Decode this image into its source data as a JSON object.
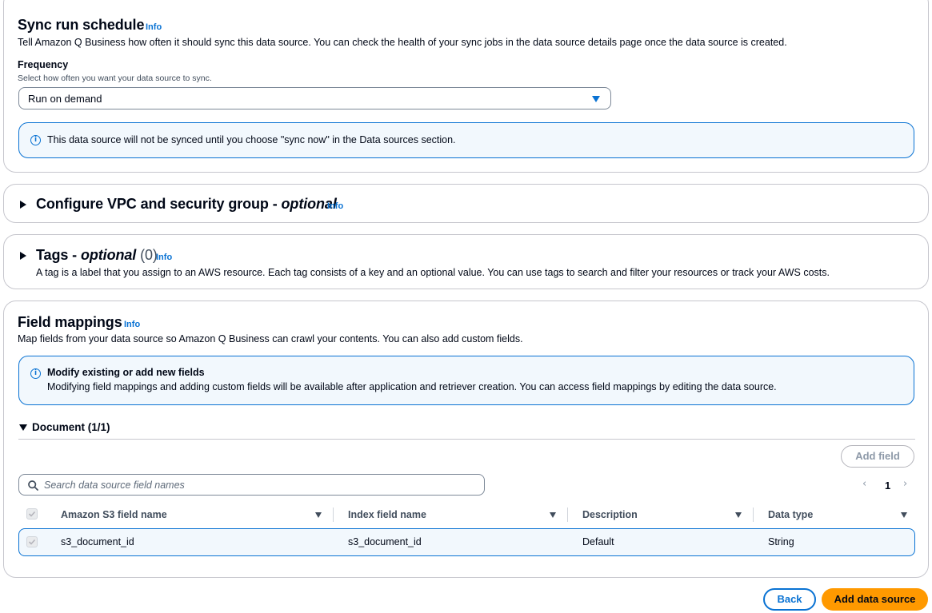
{
  "sync_schedule": {
    "title": "Sync run schedule",
    "info": "Info",
    "description": "Tell Amazon Q Business how often it should sync this data source. You can check the health of your sync jobs in the data source details page once the data source is created.",
    "frequency_label": "Frequency",
    "frequency_hint": "Select how often you want your data source to sync.",
    "frequency_value": "Run on demand",
    "alert": "This data source will not be synced until you choose \"sync now\" in the Data sources section."
  },
  "vpc": {
    "title": "Configure VPC and security group -",
    "optional": "optional",
    "info": "Info"
  },
  "tags": {
    "title": "Tags -",
    "optional": "optional",
    "count": "(0)",
    "info": "Info",
    "description": "A tag is a label that you assign to an AWS resource. Each tag consists of a key and an optional value. You can use tags to search and filter your resources or track your AWS costs."
  },
  "field_mappings": {
    "title": "Field mappings",
    "info": "Info",
    "description": "Map fields from your data source so Amazon Q Business can crawl your contents. You can also add custom fields.",
    "alert_title": "Modify existing or add new fields",
    "alert_body": "Modifying field mappings and adding custom fields will be available after application and retriever creation. You can access field mappings by editing the data source.",
    "document_section": "Document (1/1)",
    "add_field": "Add field",
    "search_placeholder": "Search data source field names",
    "page_number": "1",
    "columns": [
      "Amazon S3 field name",
      "Index field name",
      "Description",
      "Data type"
    ],
    "rows": [
      {
        "s3_field": "s3_document_id",
        "index_field": "s3_document_id",
        "description": "Default",
        "data_type": "String"
      }
    ]
  },
  "footer": {
    "back": "Back",
    "add_data_source": "Add data source"
  },
  "colors": {
    "accent": "#0972d3",
    "primary_button": "#ff9900",
    "alert_bg": "#f2f8fd"
  }
}
